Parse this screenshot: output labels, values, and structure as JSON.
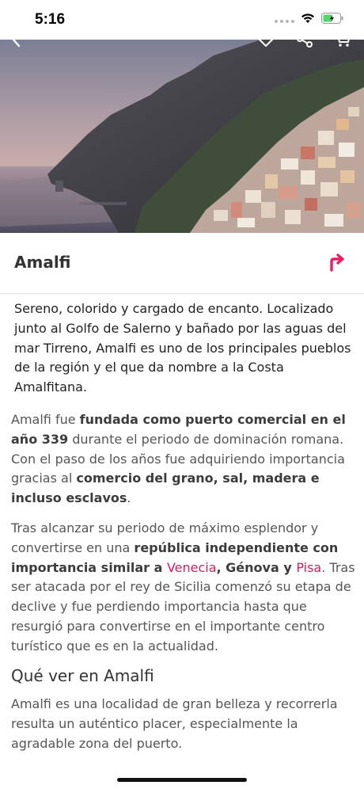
{
  "status_bar": {
    "time": "5:16"
  },
  "colors": {
    "accent": "#e91e63",
    "link": "#d81b60"
  },
  "top_bar": {
    "icons": [
      "back-icon",
      "heart-icon",
      "share-icon",
      "cart-icon"
    ]
  },
  "title": "Amalfi",
  "directions_icon": "turn-right-arrow-icon",
  "intro": "Sereno, colorido y cargado de encanto. Localizado junto al Golfo de Salerno y bañado por las aguas del mar Tirreno, Amalfi es uno de los principales pueblos de la región y el que da nombre a la Costa Amalfitana.",
  "p1": {
    "t1": "Amalfi fue ",
    "b1": "fundada como puerto comercial en el año 339",
    "t2": " durante el periodo de dominación romana. Con el paso de los años fue adquiriendo importancia gracias al ",
    "b2": "comercio del grano, sal, madera e incluso esclavos",
    "t3": "."
  },
  "p2": {
    "t1": "Tras alcanzar su periodo de máximo esplendor y convertirse en una ",
    "b1": "república independiente con importancia similar a ",
    "link1": "Venecia",
    "b2": ", Génova y ",
    "link2": "Pisa",
    "t2": ". Tras ser atacada por el rey de Sicilia comenzó su etapa de declive y fue perdiendo importancia hasta que resurgió para convertirse en el importante centro turístico que es en la actualidad."
  },
  "section_title": "Qué ver en Amalfi",
  "p3": "Amalfi es una localidad de gran belleza y recorrerla resulta un auténtico placer, especialmente la agradable zona del puerto."
}
